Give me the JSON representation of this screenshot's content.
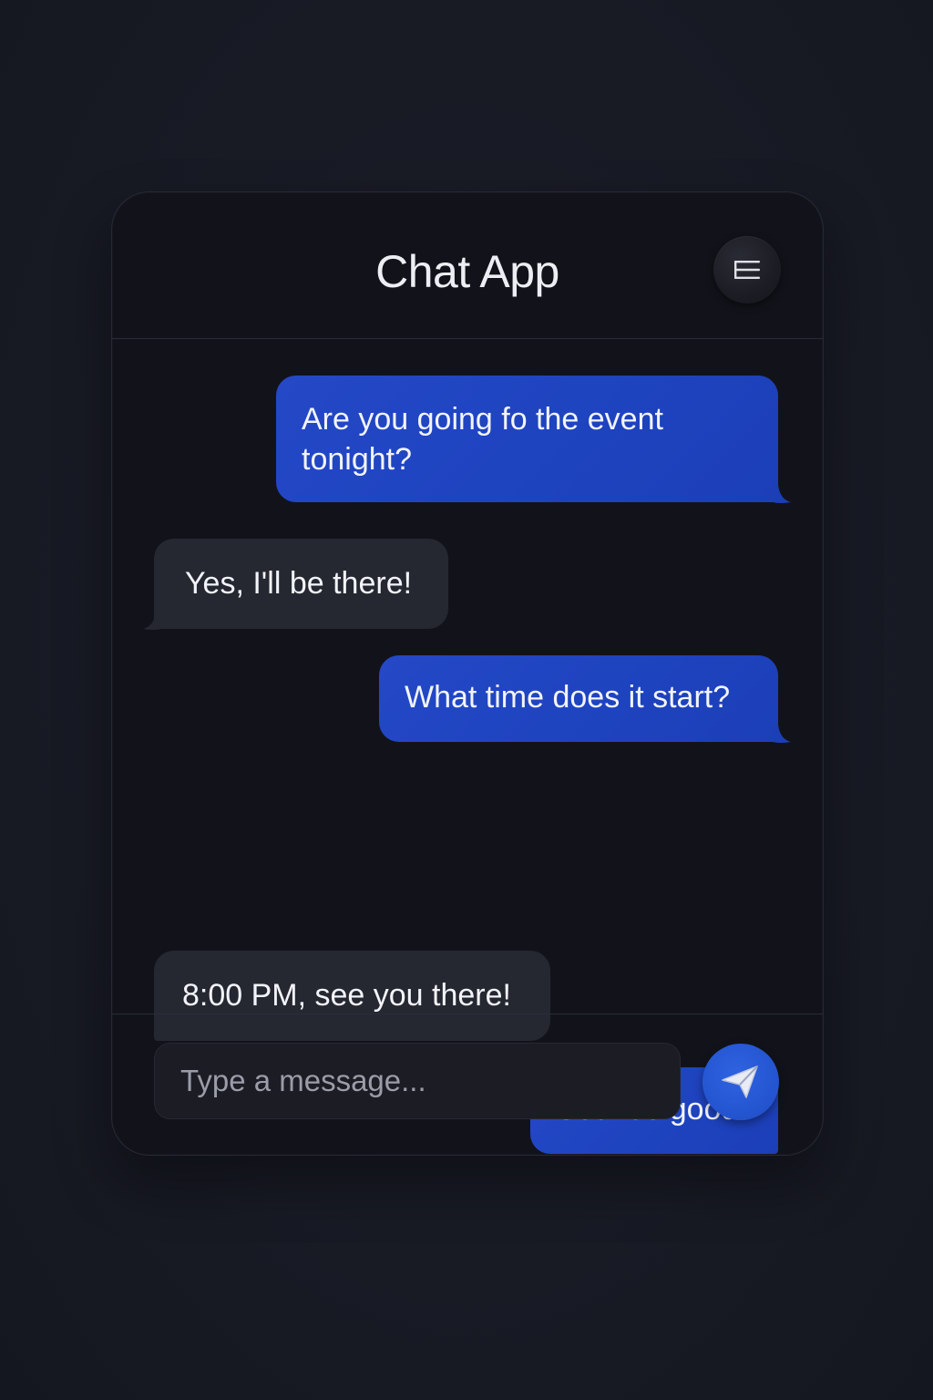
{
  "app": {
    "title": "Chat App"
  },
  "header": {
    "menu_icon": "hamburger-menu-icon"
  },
  "messages": [
    {
      "direction": "outgoing",
      "text_line1": "Are you going fo the event",
      "text_line2": "tonight?"
    },
    {
      "direction": "incoming",
      "text": "Yes, I'll be there!"
    },
    {
      "direction": "outgoing",
      "text": "What time does it start?"
    },
    {
      "direction": "incoming",
      "text": "8:00 PM, see you there!"
    },
    {
      "direction": "outgoing",
      "text": "Sounds good!"
    }
  ],
  "composer": {
    "placeholder": "Type a message...",
    "value": "",
    "send_icon": "paper-plane-icon"
  },
  "colors": {
    "background": "#181a24",
    "window": "#12131a",
    "outgoing_bubble": "#1f44c0",
    "incoming_bubble": "#252731",
    "send_button": "#2556d2",
    "text": "#f2f4fa"
  }
}
